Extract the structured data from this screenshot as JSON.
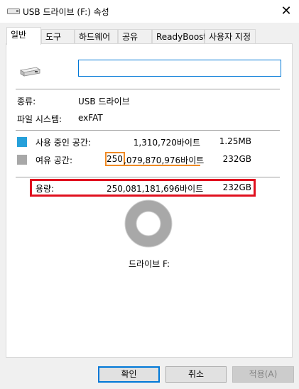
{
  "window": {
    "title": "USB 드라이브 (F:) 속성",
    "close_glyph": "✕"
  },
  "tabs": [
    {
      "label": "일반"
    },
    {
      "label": "도구"
    },
    {
      "label": "하드웨어"
    },
    {
      "label": "공유"
    },
    {
      "label": "ReadyBoost"
    },
    {
      "label": "사용자 지정"
    }
  ],
  "active_tab": "일반",
  "drive": {
    "name_value": ""
  },
  "info": {
    "type_label": "종류:",
    "type_value": "USB 드라이브",
    "fs_label": "파일 시스템:",
    "fs_value": "exFAT"
  },
  "usage": {
    "used_label": "사용 중인 공간:",
    "used_bytes": "1,310,720바이트",
    "used_size": "1.25MB",
    "used_color": "#26a0da",
    "free_label": "여유 공간:",
    "free_bytes_prefix": "250",
    "free_bytes_rest": ",079,870,976바이트",
    "free_size": "232GB",
    "free_color": "#a8a8a8",
    "capacity_label": "용량:",
    "capacity_bytes": "250,081,181,696바이트",
    "capacity_size": "232GB"
  },
  "drive_label": "드라이브 F:",
  "buttons": {
    "ok": "확인",
    "cancel": "취소",
    "apply": "적용(A)"
  },
  "colors": {
    "highlight_orange": "#f08a24",
    "highlight_red": "#e0101e",
    "accent": "#0078d7"
  }
}
